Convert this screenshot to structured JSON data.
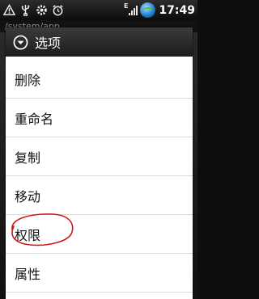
{
  "status_bar": {
    "icons": [
      "warning-icon",
      "usb-icon",
      "settings-icon",
      "alarm-icon",
      "signal-icon",
      "sync-globe-icon"
    ],
    "network_type": "E",
    "time": "17:49"
  },
  "background": {
    "path": "/system/app"
  },
  "dialog": {
    "title": "选项",
    "header_icon": "dropdown-circle-icon",
    "items": [
      {
        "label": "删除"
      },
      {
        "label": "重命名"
      },
      {
        "label": "复制"
      },
      {
        "label": "移动"
      },
      {
        "label": "权限",
        "annotated": true
      },
      {
        "label": "属性"
      }
    ],
    "annotation_color": "#d01818"
  }
}
